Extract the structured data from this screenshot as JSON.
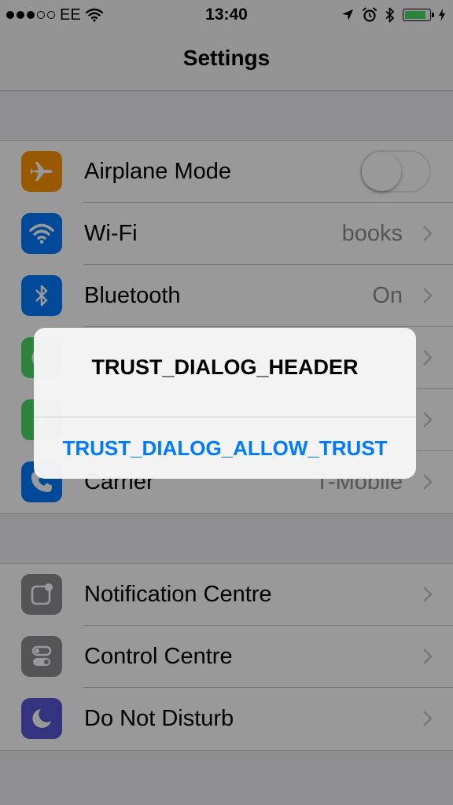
{
  "status_bar": {
    "carrier": "EE",
    "time": "13:40",
    "signal_bars_filled": 3,
    "signal_bars_total": 5,
    "battery_level": 0.85,
    "battery_color": "#4cd964"
  },
  "nav": {
    "title": "Settings"
  },
  "groups": [
    {
      "rows": [
        {
          "label": "Airplane Mode",
          "icon": "airplane-icon",
          "icon_color": "#ff9500",
          "accessory": "toggle",
          "toggle_on": false
        },
        {
          "label": "Wi-Fi",
          "icon": "wifi-icon",
          "icon_color": "#007aff",
          "value": "books",
          "accessory": "chevron"
        },
        {
          "label": "Bluetooth",
          "icon": "bluetooth-icon",
          "icon_color": "#007aff",
          "value": "On",
          "accessory": "chevron"
        },
        {
          "label": "",
          "icon": "mobile-data-icon",
          "icon_color": "#4cd964",
          "value": "",
          "accessory": "chevron"
        },
        {
          "label": "",
          "icon": "personal-hotspot-icon",
          "icon_color": "#4cd964",
          "value": "",
          "accessory": "chevron"
        },
        {
          "label": "Carrier",
          "icon": "phone-icon",
          "icon_color": "#007aff",
          "value": "T-Mobile",
          "accessory": "chevron"
        }
      ]
    },
    {
      "rows": [
        {
          "label": "Notification Centre",
          "icon": "notification-centre-icon",
          "icon_color": "#8e8e93",
          "accessory": "chevron"
        },
        {
          "label": "Control Centre",
          "icon": "control-centre-icon",
          "icon_color": "#8e8e93",
          "accessory": "chevron"
        },
        {
          "label": "Do Not Disturb",
          "icon": "moon-icon",
          "icon_color": "#5856d6",
          "accessory": "chevron"
        }
      ]
    }
  ],
  "alert": {
    "title": "TRUST_DIALOG_HEADER",
    "button": "TRUST_DIALOG_ALLOW_TRUST"
  },
  "colors": {
    "accent": "#007aff",
    "background": "#efeff4",
    "dim_overlay": "rgba(0,0,0,0.4)"
  }
}
